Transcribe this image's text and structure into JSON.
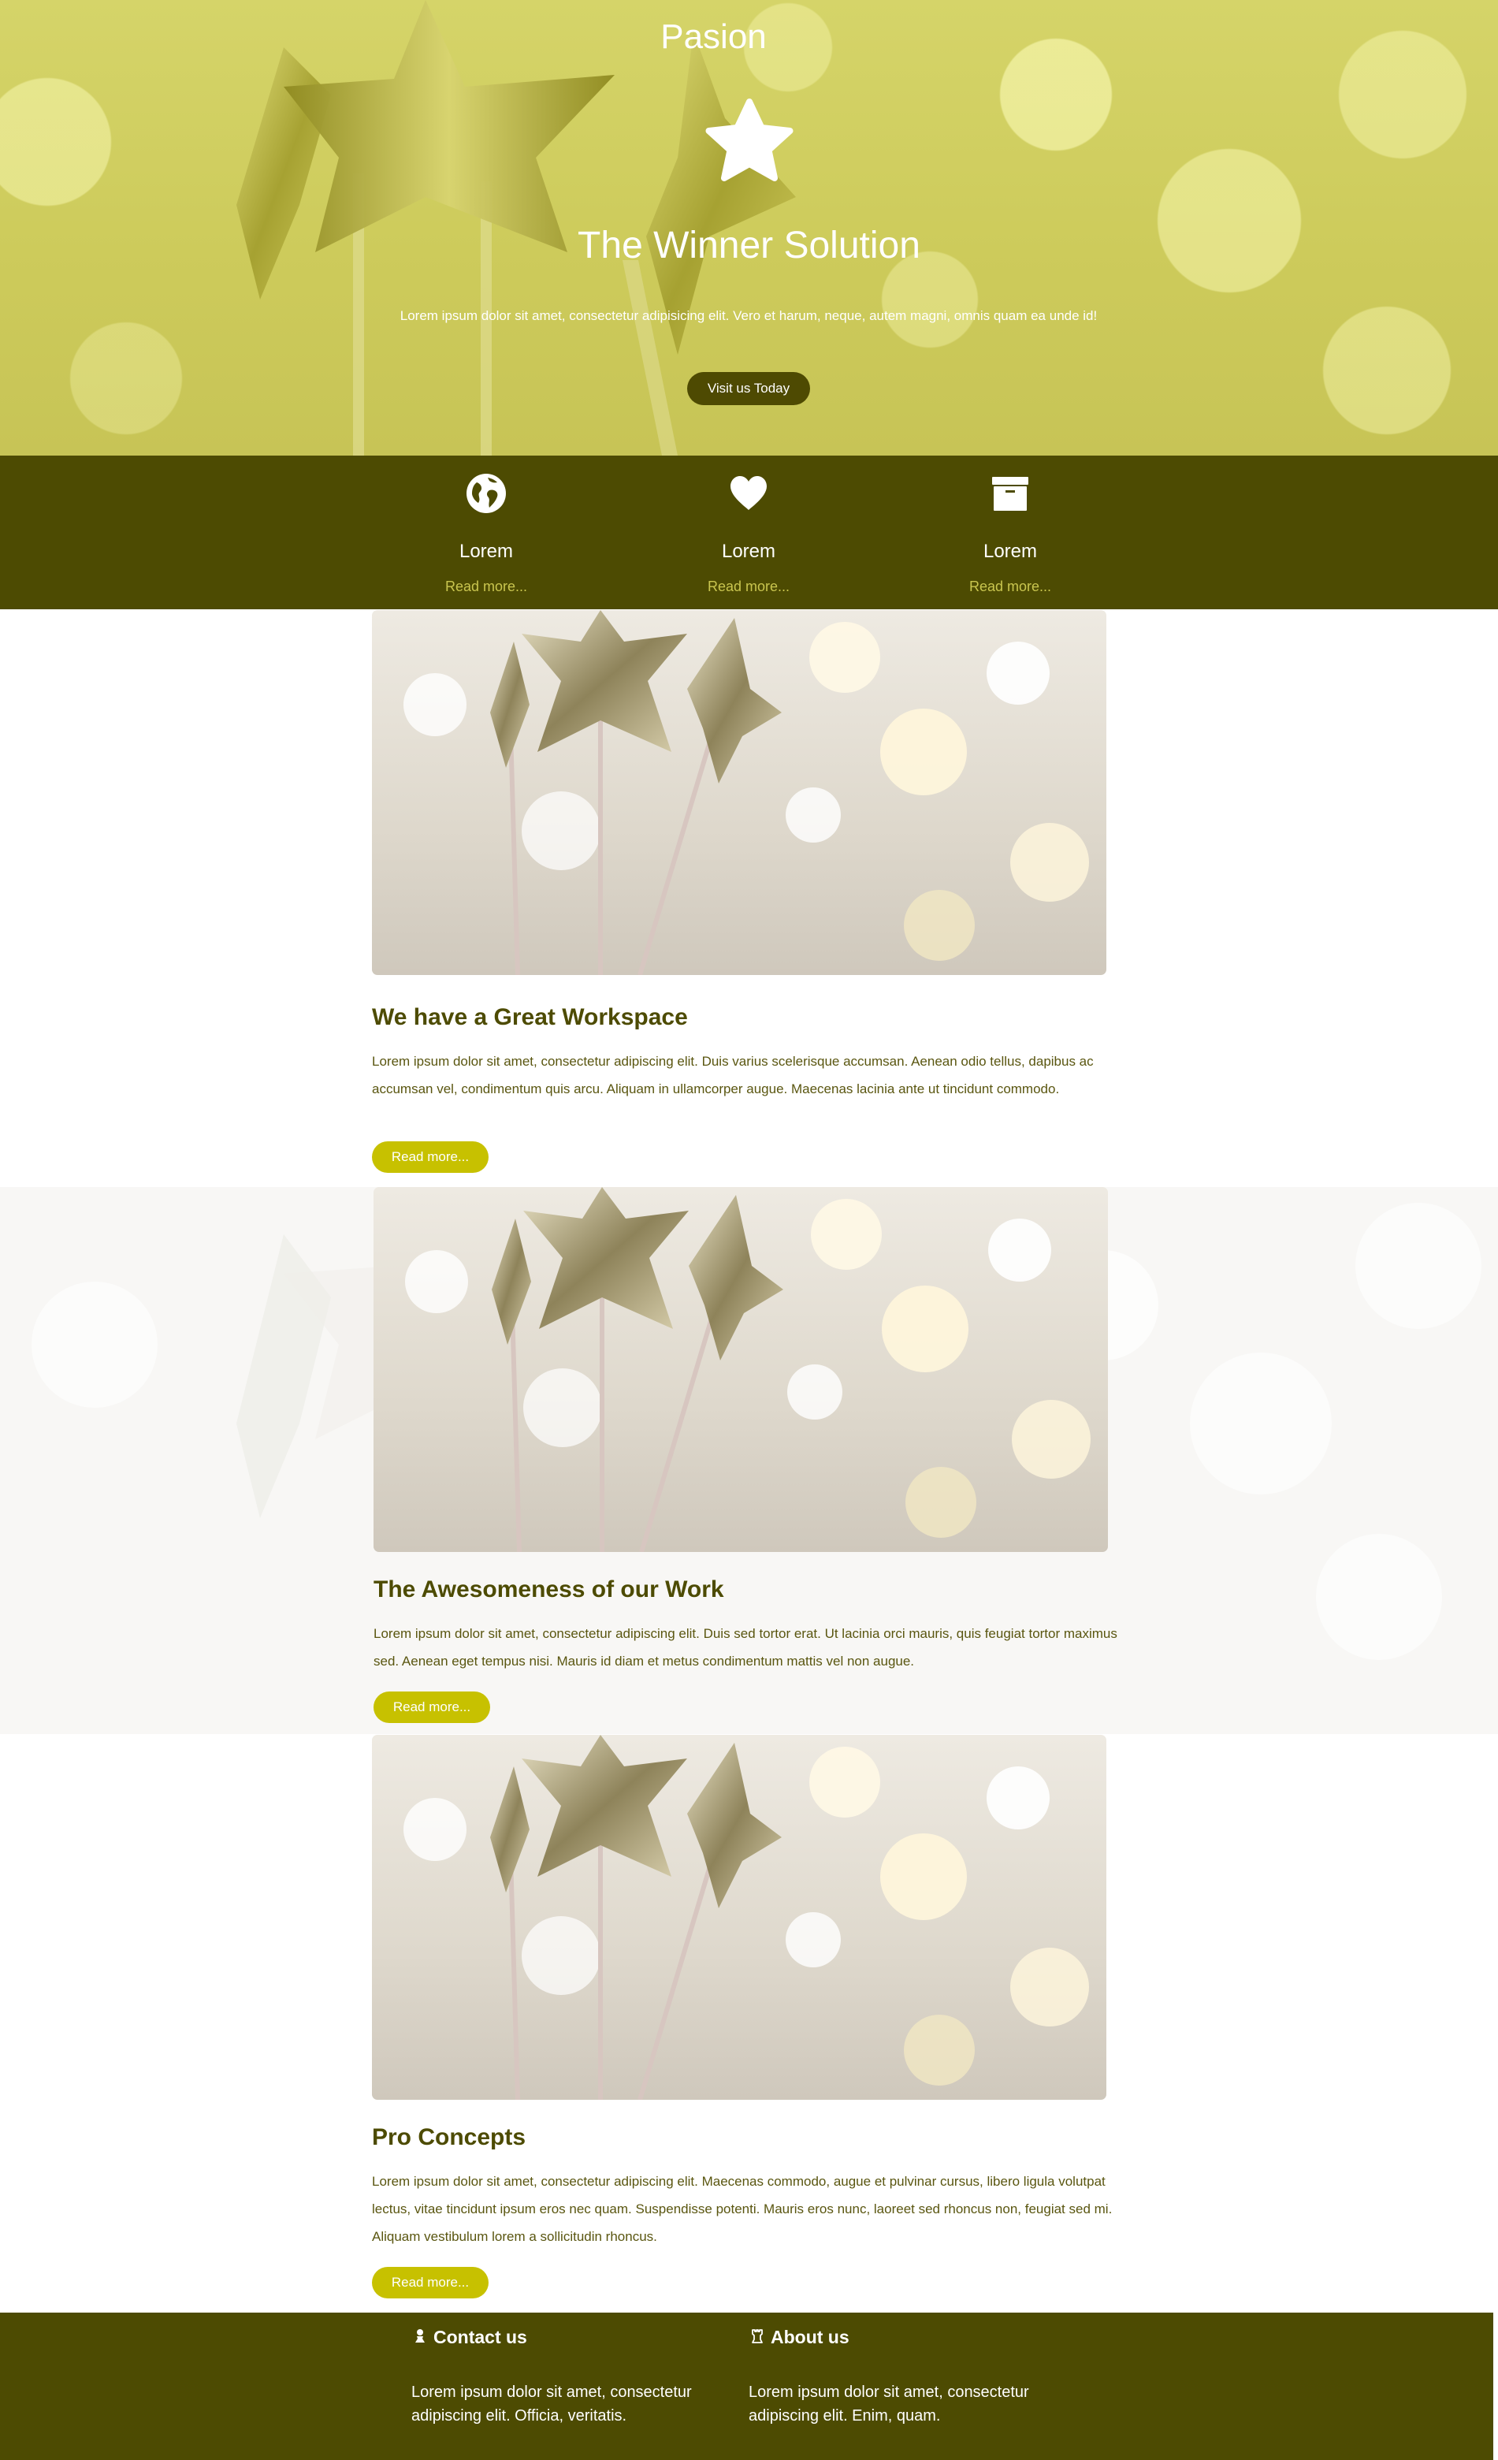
{
  "hero": {
    "brand": "Pasion",
    "title": "The Winner Solution",
    "text": "Lorem ipsum dolor sit amet, consectetur adipisicing elit. Vero et harum, neque, autem magni, omnis quam ea unde id!",
    "button_label": "Visit us Today"
  },
  "features": [
    {
      "icon": "globe-icon",
      "label": "Lorem",
      "more": "Read more..."
    },
    {
      "icon": "heart-icon",
      "label": "Lorem",
      "more": "Read more..."
    },
    {
      "icon": "archive-icon",
      "label": "Lorem",
      "more": "Read more..."
    }
  ],
  "articles": [
    {
      "title": "We have a Great Workspace",
      "text": "Lorem ipsum dolor sit amet, consectetur adipiscing elit. Duis varius scelerisque accumsan. Aenean odio tellus, dapibus ac accumsan vel, condimentum quis arcu. Aliquam in ullamcorper augue. Maecenas lacinia ante ut tincidunt commodo.",
      "button_label": "Read more..."
    },
    {
      "title": "The Awesomeness of our Work",
      "text": "Lorem ipsum dolor sit amet, consectetur adipiscing elit. Duis sed tortor erat. Ut lacinia orci mauris, quis feugiat tortor maximus sed. Aenean eget tempus nisi. Mauris id diam et metus condimentum mattis vel non augue.",
      "button_label": "Read more..."
    },
    {
      "title": "Pro Concepts",
      "text": "Lorem ipsum dolor sit amet, consectetur adipiscing elit. Maecenas commodo, augue et pulvinar cursus, libero ligula volutpat lectus, vitae tincidunt ipsum eros nec quam. Suspendisse potenti. Mauris eros nunc, laoreet sed rhoncus non, feugiat sed mi. Aliquam vestibulum lorem a sollicitudin rhoncus.",
      "button_label": "Read more..."
    }
  ],
  "footer": {
    "contact": {
      "icon": "pawn-icon",
      "title": "Contact us",
      "text": "Lorem ipsum dolor sit amet, consectetur adipiscing elit. Officia, veritatis."
    },
    "about": {
      "icon": "rook-icon",
      "title": "About us",
      "text": "Lorem ipsum dolor sit amet, consectetur adipiscing elit. Enim, quam."
    }
  },
  "colors": {
    "hero_tint": "#d1d063",
    "dark_olive": "#4d4b02",
    "accent": "#c7c100",
    "link_yellow": "#c9c54f"
  }
}
